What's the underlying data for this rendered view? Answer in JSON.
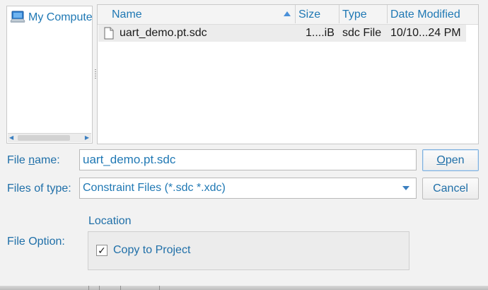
{
  "places": {
    "items": [
      {
        "label": "My Computer",
        "icon": "computer-icon"
      }
    ]
  },
  "file_list": {
    "columns": {
      "name": "Name",
      "size": "Size",
      "type": "Type",
      "date_modified": "Date Modified"
    },
    "sort_icon": "sort-ascending-icon",
    "rows": [
      {
        "icon": "document-icon",
        "name": "uart_demo.pt.sdc",
        "size": "1....iB",
        "type": "sdc File",
        "date_modified": "10/10...24 PM"
      }
    ]
  },
  "form": {
    "file_name_label_pre": "File ",
    "file_name_label_ul": "n",
    "file_name_label_post": "ame:",
    "file_name_value": "uart_demo.pt.sdc",
    "files_of_type_label": "Files of type:",
    "files_of_type_value": "Constraint Files (*.sdc *.xdc)",
    "open_ul": "O",
    "open_rest": "pen",
    "cancel_label": "Cancel",
    "file_option_label": "File Option:",
    "location_title": "Location",
    "copy_to_project_label": "Copy to Project",
    "copy_to_project_checked": true,
    "check_glyph": "✓"
  },
  "colors": {
    "accent": "#1f6fa8",
    "text_dark": "#1a1a1a",
    "background": "#f2f2f2"
  }
}
